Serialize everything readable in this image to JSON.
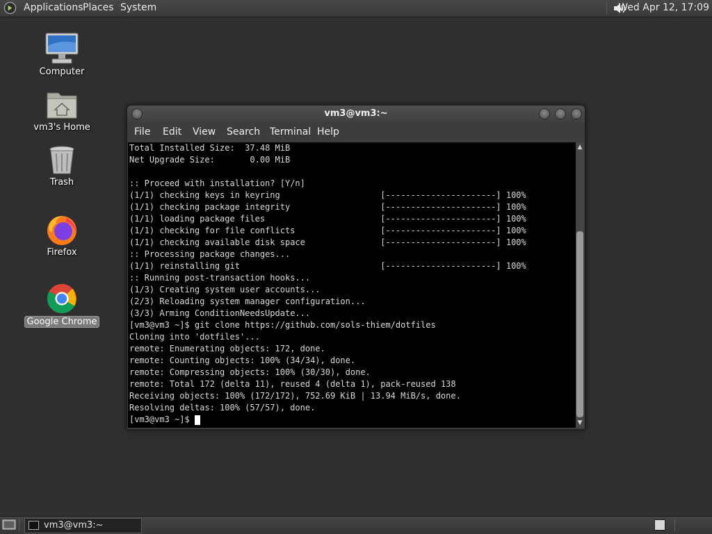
{
  "top_panel": {
    "menus": [
      "Applications",
      "Places",
      "System"
    ],
    "clock": "Wed Apr 12, 17:09"
  },
  "desktop_icons": [
    {
      "label": "Computer",
      "icon": "computer-icon"
    },
    {
      "label": "vm3's Home",
      "icon": "home-folder-icon"
    },
    {
      "label": "Trash",
      "icon": "trash-icon"
    },
    {
      "label": "Firefox",
      "icon": "firefox-icon"
    },
    {
      "label": "Google Chrome",
      "icon": "chrome-icon",
      "selected": true
    }
  ],
  "window": {
    "title": "vm3@vm3:~",
    "menus": [
      "File",
      "Edit",
      "View",
      "Search",
      "Terminal",
      "Help"
    ]
  },
  "terminal": {
    "lines": [
      "Total Installed Size:  37.48 MiB",
      "Net Upgrade Size:       0.00 MiB",
      "",
      ":: Proceed with installation? [Y/n]",
      "(1/1) checking keys in keyring                    [----------------------] 100%",
      "(1/1) checking package integrity                  [----------------------] 100%",
      "(1/1) loading package files                       [----------------------] 100%",
      "(1/1) checking for file conflicts                 [----------------------] 100%",
      "(1/1) checking available disk space               [----------------------] 100%",
      ":: Processing package changes...",
      "(1/1) reinstalling git                            [----------------------] 100%",
      ":: Running post-transaction hooks...",
      "(1/3) Creating system user accounts...",
      "(2/3) Reloading system manager configuration...",
      "(3/3) Arming ConditionNeedsUpdate...",
      "[vm3@vm3 ~]$ git clone https://github.com/sols-thiem/dotfiles",
      "Cloning into 'dotfiles'...",
      "remote: Enumerating objects: 172, done.",
      "remote: Counting objects: 100% (34/34), done.",
      "remote: Compressing objects: 100% (30/30), done.",
      "remote: Total 172 (delta 11), reused 4 (delta 1), pack-reused 138",
      "Receiving objects: 100% (172/172), 752.69 KiB | 13.94 MiB/s, done.",
      "Resolving deltas: 100% (57/57), done."
    ],
    "prompt": "[vm3@vm3 ~]$ "
  },
  "taskbar": {
    "window_button_label": "vm3@vm3:~"
  },
  "colors": {
    "desktop_bg": "#2f2f2f",
    "terminal_bg": "#000000",
    "terminal_fg": "#d8d8d8",
    "panel_bg": "#3a3a3a"
  }
}
